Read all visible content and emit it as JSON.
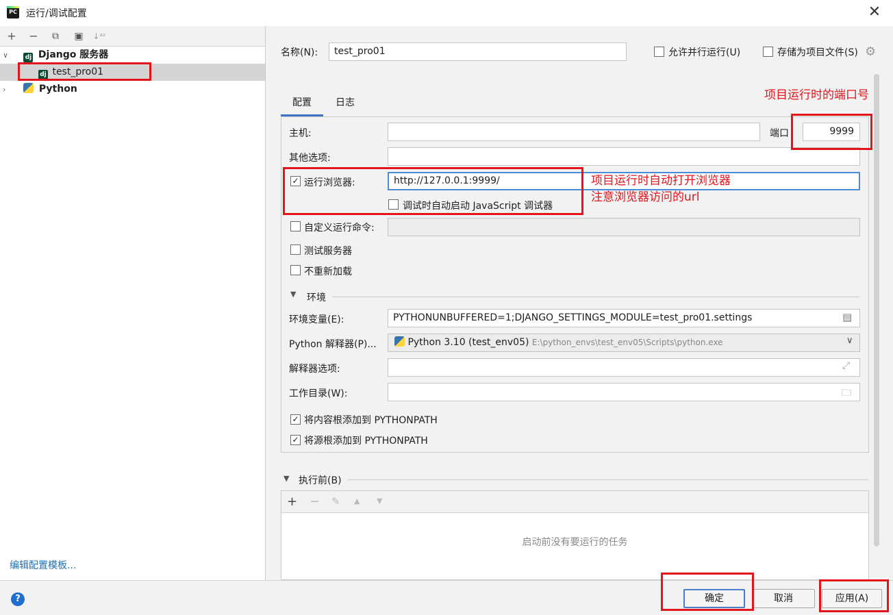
{
  "window": {
    "title": "运行/调试配置",
    "app_icon_text": "PC"
  },
  "left": {
    "toolbar": {
      "add": "+",
      "remove": "−",
      "copy": "⧉",
      "new_folder": "▣",
      "sort": "↓ᵃᶻ"
    },
    "tree": [
      {
        "label": "Django 服务器",
        "icon": "django-icon",
        "expanded": true
      },
      {
        "label": "test_pro01",
        "icon": "django-icon",
        "selected": true
      },
      {
        "label": "Python",
        "icon": "python-icon",
        "expanded": false
      }
    ],
    "edit_templates": "编辑配置模板..."
  },
  "form": {
    "name_label": "名称(N):",
    "name_value": "test_pro01",
    "allow_parallel": "允许并行运行(U)",
    "store_as_file": "存储为项目文件(S)",
    "tabs": [
      "配置",
      "日志"
    ],
    "host_label": "主机:",
    "host_value": "",
    "port_label": "端口",
    "port_value": "9999",
    "options_label": "其他选项:",
    "run_browser_label": "运行浏览器:",
    "run_browser_url": "http://127.0.0.1:9999/",
    "js_debug_label": "调试时自动启动 JavaScript 调试器",
    "custom_cmd_label": "自定义运行命令:",
    "test_server_label": "测试服务器",
    "no_reload_label": "不重新加载",
    "env_section": "环境",
    "env_vars_label": "环境变量(E):",
    "env_vars_value": "PYTHONUNBUFFERED=1;DJANGO_SETTINGS_MODULE=test_pro01.settings",
    "interpreter_label": "Python 解释器(P)...",
    "interpreter_name": "Python 3.10 (test_env05)",
    "interpreter_path": "E:\\python_envs\\test_env05\\Scripts\\python.exe",
    "interp_options_label": "解释器选项:",
    "workdir_label": "工作目录(W):",
    "add_content_roots": "将内容根添加到 PYTHONPATH",
    "add_source_roots": "将源根添加到 PYTHONPATH",
    "before_launch": "执行前(B)",
    "no_tasks": "启动前没有要运行的任务"
  },
  "annotations": {
    "port_note": "项目运行时的端口号",
    "browser_note_1": "项目运行时自动打开浏览器",
    "browser_note_2": "注意浏览器访问的url"
  },
  "buttons": {
    "ok": "确定",
    "cancel": "取消",
    "apply": "应用(A)",
    "help": "?"
  },
  "colors": {
    "annotation_red": "#e3141b",
    "focus_blue": "#4b8cd8",
    "link_blue": "#2470b3"
  }
}
